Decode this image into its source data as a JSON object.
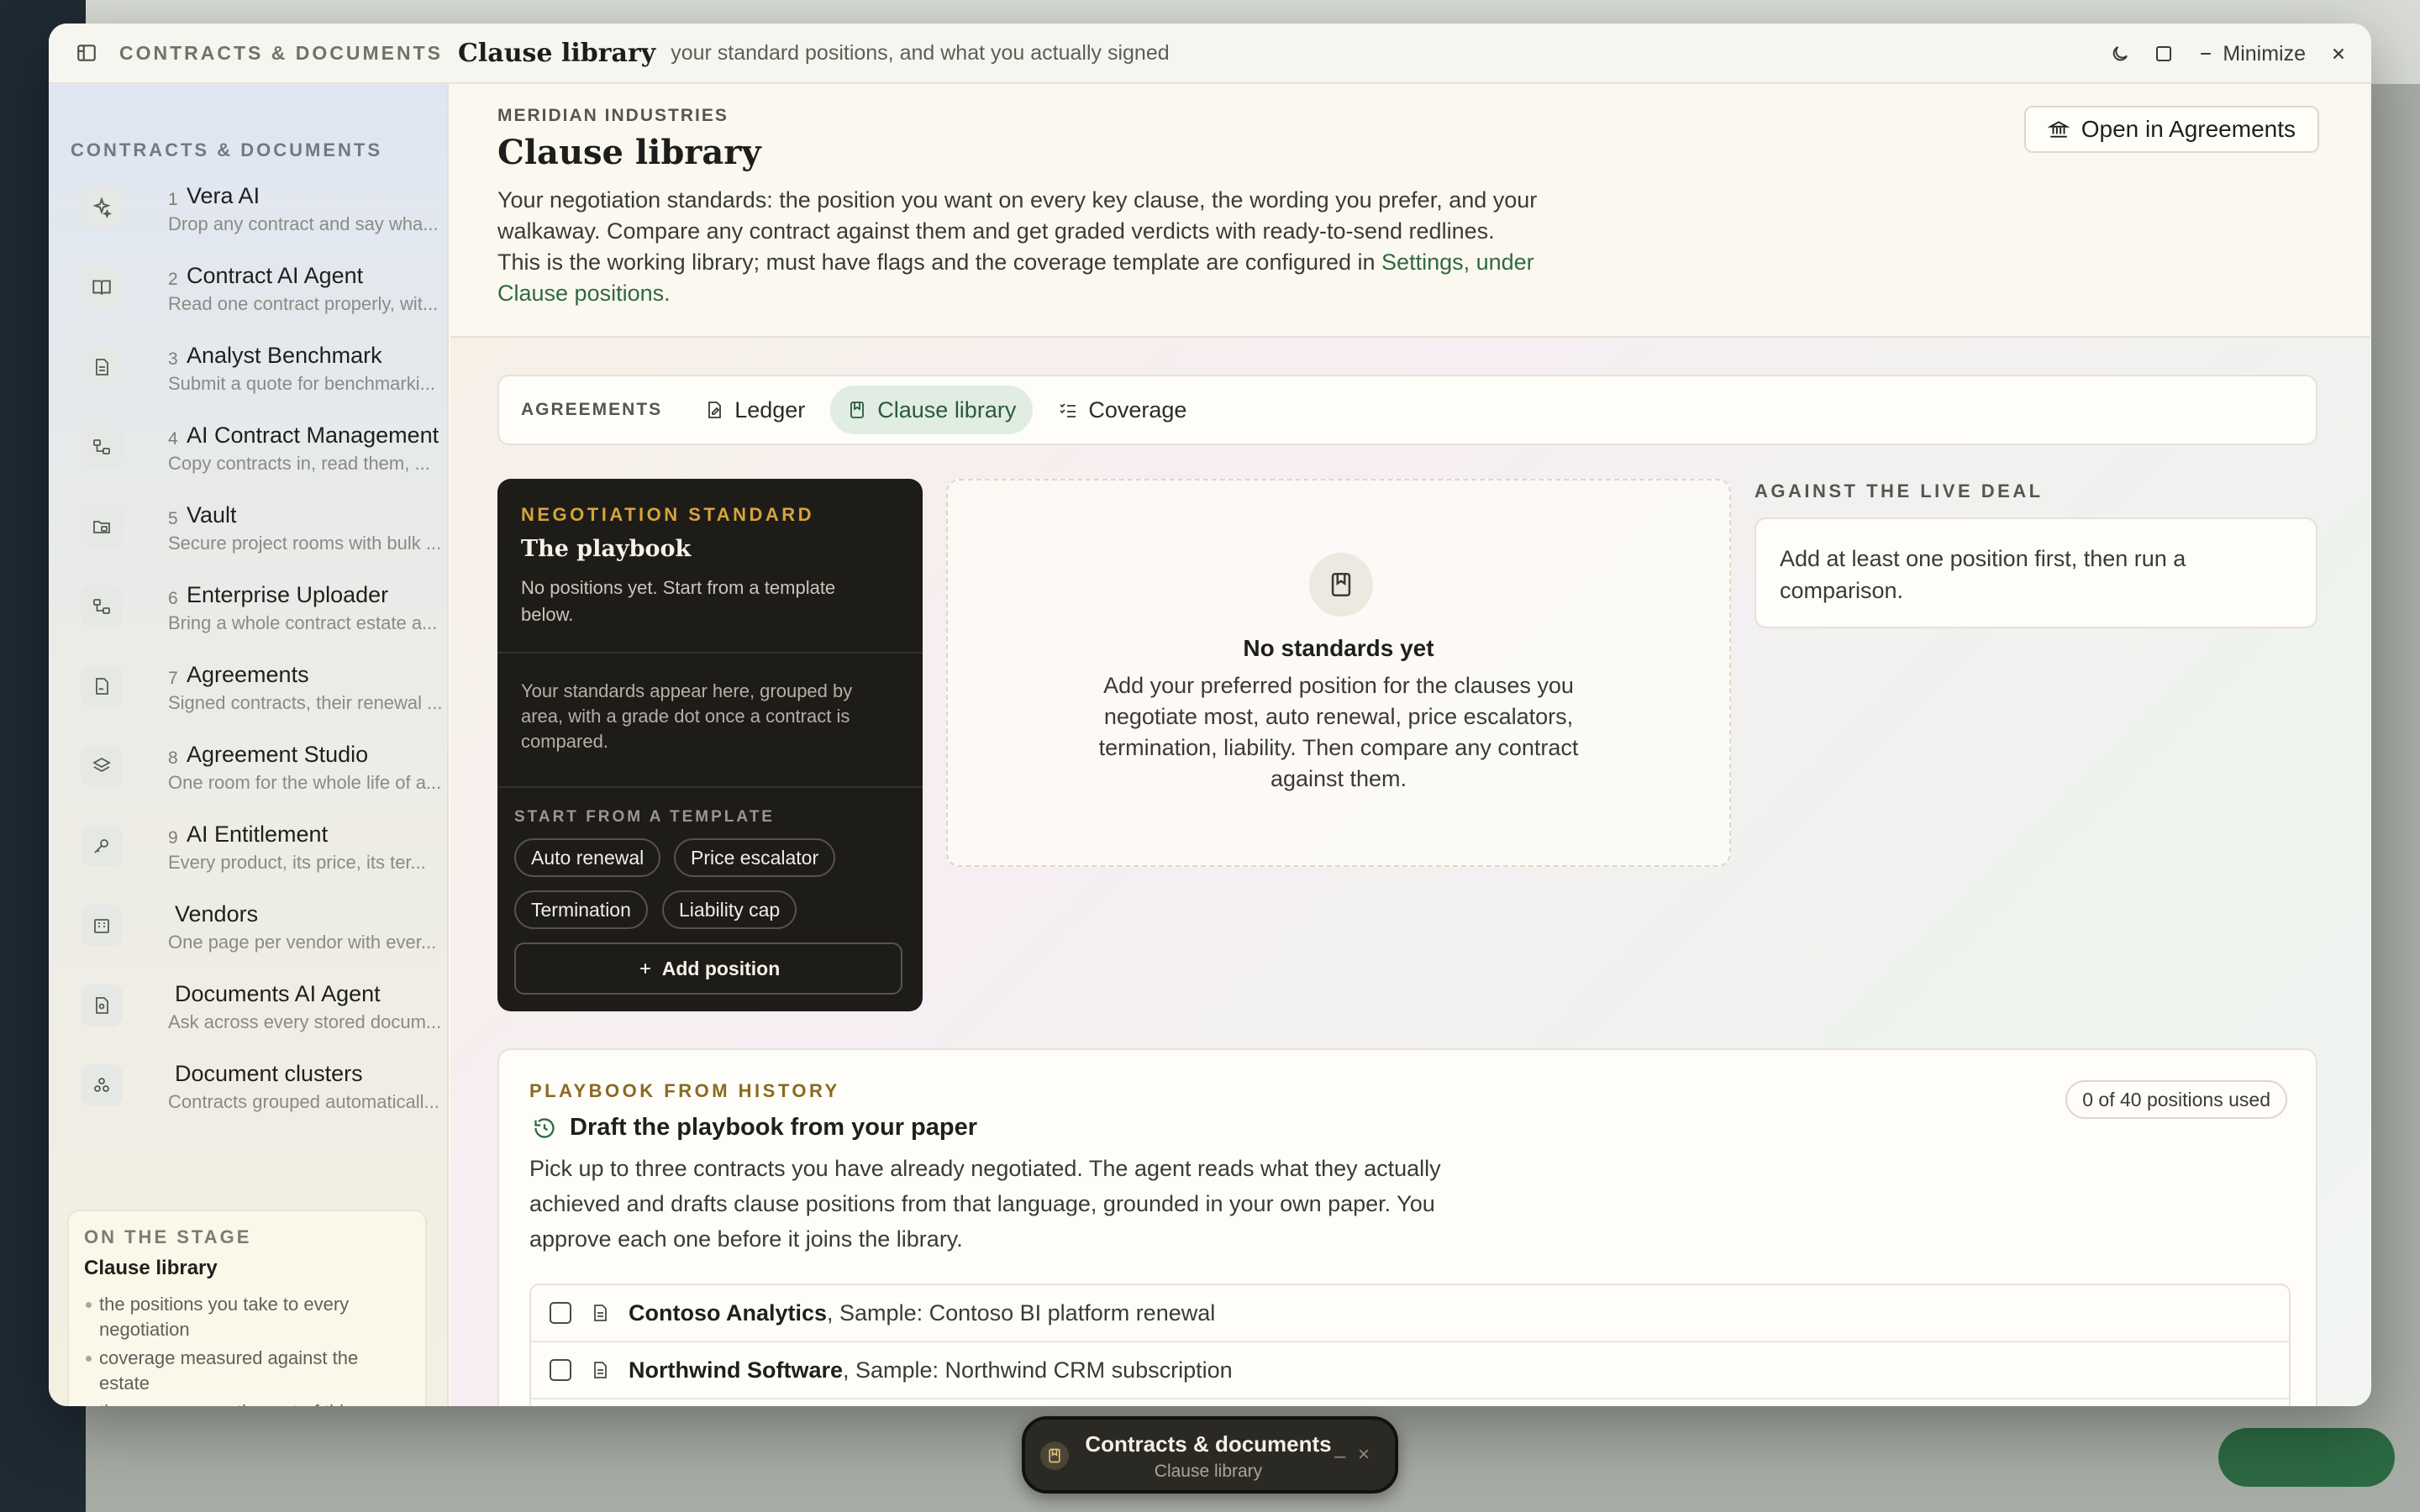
{
  "window": {
    "kicker": "CONTRACTS & DOCUMENTS",
    "title": "Clause library",
    "subtitle": "your standard positions, and what you actually signed",
    "minimize_label": "Minimize"
  },
  "sidebar": {
    "heading": "CONTRACTS & DOCUMENTS",
    "items": [
      {
        "num": "1",
        "title": "Vera AI",
        "desc": "Drop any contract and say wha...",
        "icon": "sparkles-icon"
      },
      {
        "num": "2",
        "title": "Contract AI Agent",
        "desc": "Read one contract properly, wit...",
        "icon": "book-open-icon"
      },
      {
        "num": "3",
        "title": "Analyst Benchmark",
        "desc": "Submit a quote for benchmarki...",
        "icon": "document-icon"
      },
      {
        "num": "4",
        "title": "AI Contract Management",
        "desc": "Copy contracts in, read them, ...",
        "icon": "flow-icon"
      },
      {
        "num": "5",
        "title": "Vault",
        "desc": "Secure project rooms with bulk ...",
        "icon": "folder-lock-icon"
      },
      {
        "num": "6",
        "title": "Enterprise Uploader",
        "desc": "Bring a whole contract estate a...",
        "icon": "upload-flow-icon"
      },
      {
        "num": "7",
        "title": "Agreements",
        "desc": "Signed contracts, their renewal ...",
        "icon": "signed-doc-icon"
      },
      {
        "num": "8",
        "title": "Agreement Studio",
        "desc": "One room for the whole life of a...",
        "icon": "layers-icon"
      },
      {
        "num": "9",
        "title": "AI Entitlement",
        "desc": "Every product, its price, its ter...",
        "icon": "key-icon"
      },
      {
        "num": "",
        "title": "Vendors",
        "desc": "One page per vendor with ever...",
        "icon": "building-icon"
      },
      {
        "num": "",
        "title": "Documents AI Agent",
        "desc": "Ask across every stored docum...",
        "icon": "doc-search-icon"
      },
      {
        "num": "",
        "title": "Document clusters",
        "desc": "Contracts grouped automaticall...",
        "icon": "clusters-icon"
      }
    ],
    "stage": {
      "kicker": "ON THE STAGE",
      "title": "Clause library",
      "bullets": [
        "the positions you take to every negotiation",
        "coverage measured against the estate",
        "the menu opens the rest of this group"
      ]
    }
  },
  "hero": {
    "kicker": "MERIDIAN INDUSTRIES",
    "title": "Clause library",
    "body": "Your negotiation standards: the position you want on every key clause, the wording you prefer, and your walkaway. Compare any contract against them and get graded verdicts with ready-to-send redlines. This is the working library; must have flags and the coverage template are configured in ",
    "link": "Settings, under Clause positions.",
    "open_button": "Open in Agreements"
  },
  "tabs": {
    "kicker": "AGREEMENTS",
    "items": [
      {
        "label": "Ledger",
        "icon": "ledger-icon",
        "active": false
      },
      {
        "label": "Clause library",
        "icon": "bookmark-icon",
        "active": true
      },
      {
        "label": "Coverage",
        "icon": "checklist-icon",
        "active": false
      }
    ]
  },
  "playbook": {
    "kicker": "NEGOTIATION STANDARD",
    "title": "The playbook",
    "text": "No positions yet. Start from a template below.",
    "text2": "Your standards appear here, grouped by area, with a grade dot once a contract is compared.",
    "templates_kicker": "START FROM A TEMPLATE",
    "templates": [
      "Auto renewal",
      "Price escalator",
      "Termination",
      "Liability cap"
    ],
    "add_label": "Add position"
  },
  "empty_state": {
    "title": "No standards yet",
    "text": "Add your preferred position for the clauses you negotiate most, auto renewal, price escalators, termination, liability. Then compare any contract against them."
  },
  "live_deal": {
    "kicker": "AGAINST THE LIVE DEAL",
    "text": "Add at least one position first, then run a comparison."
  },
  "history": {
    "kicker": "PLAYBOOK FROM HISTORY",
    "title": "Draft the playbook from your paper",
    "text": "Pick up to three contracts you have already negotiated. The agent reads what they actually achieved and drafts clause positions from that language, grounded in your own paper. You approve each one before it joins the library.",
    "usage": "0 of 40 positions used",
    "contracts": [
      {
        "vendor": "Contoso Analytics",
        "desc": ", Sample: Contoso BI platform renewal"
      },
      {
        "vendor": "Northwind Software",
        "desc": ", Sample: Northwind CRM subscription"
      }
    ]
  },
  "dock": {
    "title": "Contracts & documents",
    "subtitle": "Clause library"
  },
  "colors": {
    "accent_green": "#2f6a3f",
    "dark_card": "#1d1c18",
    "gold": "#d7a43a"
  }
}
